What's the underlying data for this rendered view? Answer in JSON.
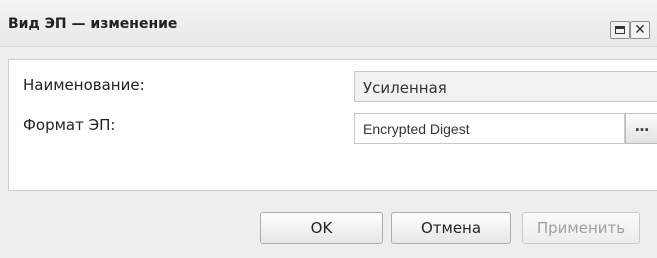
{
  "window": {
    "title": "Вид ЭП — изменение"
  },
  "form": {
    "name_label": "Наименование:",
    "name_value": "Усиленная",
    "format_label": "Формат ЭП:",
    "format_value": "Encrypted Digest",
    "lookup_label": "..."
  },
  "buttons": {
    "ok": "OK",
    "cancel": "Отмена",
    "apply": "Применить"
  },
  "icons": {
    "maximize": "maximize-icon",
    "close": "close-icon"
  }
}
